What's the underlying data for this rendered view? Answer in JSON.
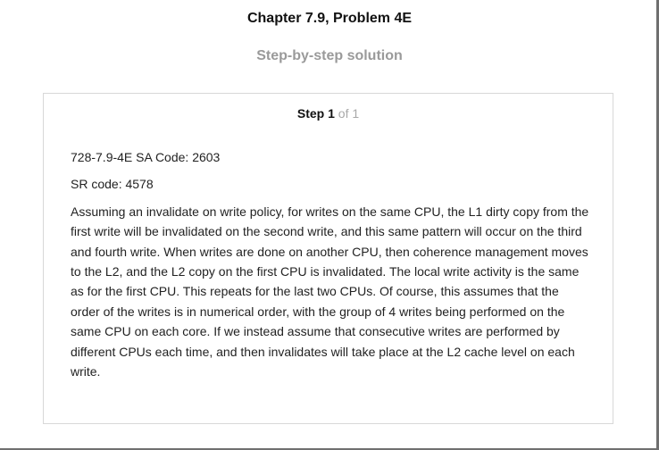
{
  "header": {
    "chapter_title": "Chapter 7.9, Problem 4E",
    "solution_heading": "Step-by-step solution"
  },
  "step": {
    "label": "Step",
    "number": "1",
    "of_total": "of 1",
    "lines": [
      "728-7.9-4E SA Code: 2603",
      "SR code: 4578",
      "Assuming an invalidate on write policy, for writes on the same CPU, the L1 dirty copy from the first write will be invalidated on the second write, and this same pattern will occur on the third and fourth write. When writes are done on another CPU, then coherence management moves to the L2, and the L2 copy on the first CPU is invalidated. The local write activity is the same as for the first CPU. This repeats for the last two CPUs. Of course, this assumes that the order of the writes is in numerical order, with the group of 4 writes being performed on the same CPU on each core. If we instead assume that consecutive writes are performed by different CPUs each time, and then invalidates will take place at the L2 cache level on each write."
    ]
  }
}
